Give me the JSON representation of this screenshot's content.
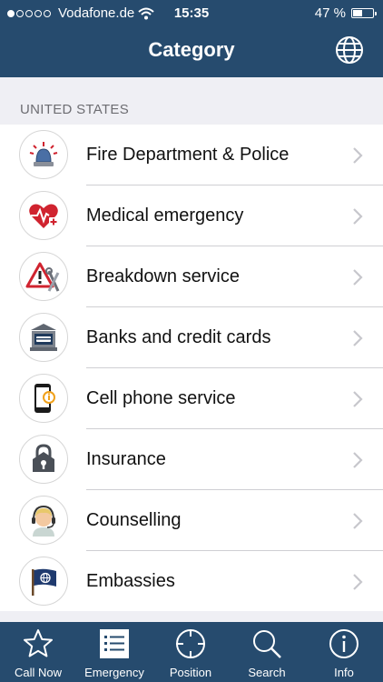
{
  "status_bar": {
    "carrier": "Vodafone.de",
    "time": "15:35",
    "battery": "47 %",
    "battery_level": 0.47
  },
  "header": {
    "title": "Category",
    "globe_icon": "globe-icon"
  },
  "section": {
    "title": "UNITED STATES"
  },
  "items": [
    {
      "label": "Fire Department & Police",
      "icon": "siren-icon"
    },
    {
      "label": "Medical emergency",
      "icon": "heart-pulse-icon"
    },
    {
      "label": "Breakdown service",
      "icon": "warning-tools-icon"
    },
    {
      "label": "Banks and credit cards",
      "icon": "bank-icon"
    },
    {
      "label": "Cell phone service",
      "icon": "cell-phone-icon"
    },
    {
      "label": "Insurance",
      "icon": "insurance-lock-icon"
    },
    {
      "label": "Counselling",
      "icon": "headset-person-icon"
    },
    {
      "label": "Embassies",
      "icon": "flag-icon"
    }
  ],
  "tabs": [
    {
      "label": "Call Now",
      "icon": "star-icon"
    },
    {
      "label": "Emergency",
      "icon": "list-icon",
      "selected": true
    },
    {
      "label": "Position",
      "icon": "crosshair-icon"
    },
    {
      "label": "Search",
      "icon": "search-icon"
    },
    {
      "label": "Info",
      "icon": "info-icon"
    }
  ],
  "colors": {
    "header_bg": "#264b6e",
    "accent_red": "#d0232f",
    "section_bg": "#efeff4"
  }
}
